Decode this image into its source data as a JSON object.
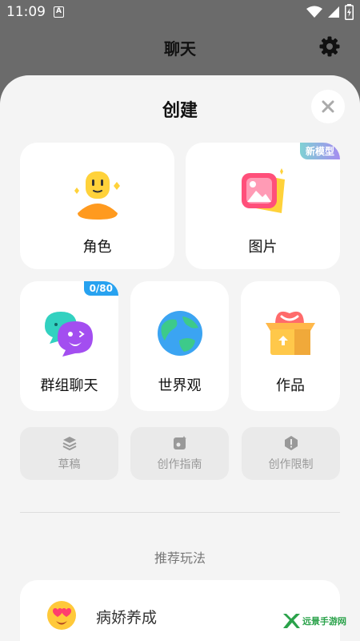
{
  "status_bar": {
    "time": "11:09",
    "notification_letter": "A"
  },
  "header": {
    "title": "聊天"
  },
  "create_sheet": {
    "title": "创建",
    "cards": {
      "character": {
        "label": "角色"
      },
      "image": {
        "label": "图片",
        "badge": "新模型"
      },
      "group_chat": {
        "label": "群组聊天",
        "badge": "0/80"
      },
      "worldview": {
        "label": "世界观"
      },
      "works": {
        "label": "作品"
      }
    },
    "shortcuts": [
      {
        "label": "草稿",
        "icon": "layers-icon"
      },
      {
        "label": "创作指南",
        "icon": "guide-icon"
      },
      {
        "label": "创作限制",
        "icon": "alert-icon"
      }
    ]
  },
  "recommend": {
    "section_title": "推荐玩法",
    "items": [
      {
        "label": "病娇养成",
        "icon": "heart-eyes-emoji-icon"
      }
    ]
  },
  "watermark": {
    "text": "远景手游网"
  },
  "colors": {
    "accent_blue": "#27a2f0",
    "background_sheet": "#f4f4f4",
    "overlay": "#6b6b6b",
    "watermark_green": "#2aa24a"
  }
}
